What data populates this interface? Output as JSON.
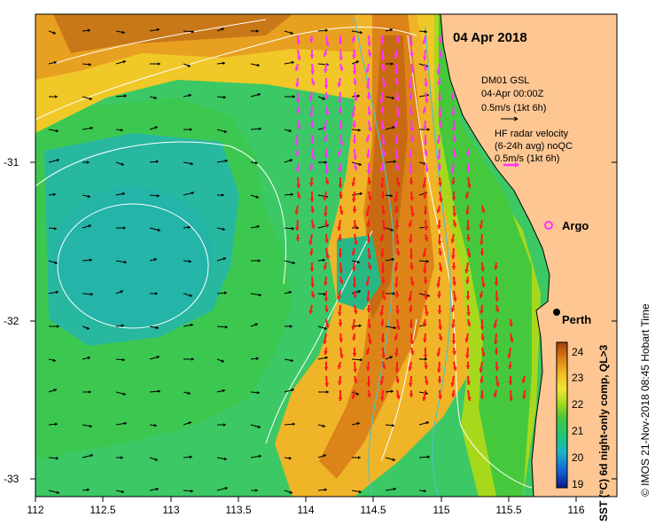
{
  "map": {
    "date": "04 Apr 2018",
    "model_legend": {
      "line1": "DM01 GSL",
      "line2": "04-Apr 00:00Z",
      "line3": "0.5m/s (1kt 6h)"
    },
    "radar_legend": {
      "line1": "HF radar velocity",
      "line2": "(6-24h avg) noQC",
      "line3": "0.5m/s (1kt 6h)"
    },
    "argo_label": "Argo",
    "city_label": "Perth",
    "colors": {
      "land": "#fdc693",
      "model_arrow": "#000000",
      "radar_arrow_magenta": "#ff33ff",
      "radar_arrow_red": "#ff1a1a",
      "contour": "#ffffff",
      "bathymetry": "#4fc3c3"
    }
  },
  "axes": {
    "x_ticks": [
      "112",
      "112.5",
      "113",
      "113.5",
      "114",
      "114.5",
      "115",
      "115.5",
      "116"
    ],
    "y_ticks": [
      "-31",
      "-32",
      "-33"
    ]
  },
  "colorbar": {
    "label": "SST (°C) 6d night-only comp, QL>3",
    "ticks": [
      "24",
      "23",
      "22",
      "21",
      "20",
      "19"
    ],
    "colors": [
      "#0a1a8c",
      "#1565d8",
      "#1ab4c8",
      "#1ec878",
      "#46c83c",
      "#a8d81c",
      "#f0e632",
      "#f0b41e",
      "#dc7814",
      "#a0400a"
    ]
  },
  "credit": "© IMOS 21-Nov-2018 08:45 Hobart Time"
}
